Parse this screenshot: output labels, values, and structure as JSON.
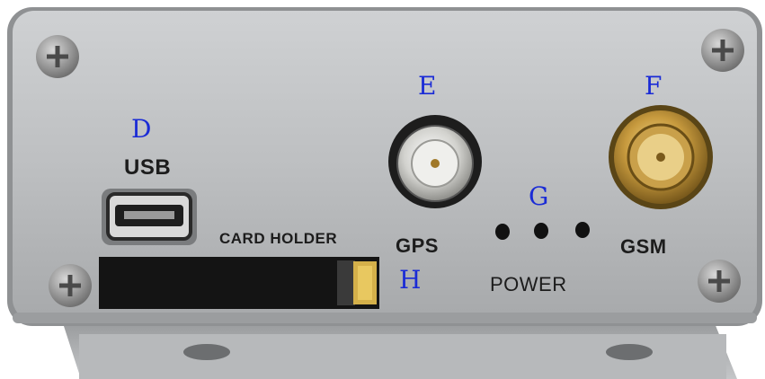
{
  "device": {
    "labels": {
      "usb": "USB",
      "card_holder": "CARD HOLDER",
      "gps": "GPS",
      "gsm": "GSM",
      "power": "POWER"
    },
    "markers": {
      "d": "D",
      "e": "E",
      "f": "F",
      "g": "G",
      "h": "H"
    },
    "colors": {
      "panel": "#b9bcbe",
      "marker_text": "#1a2bd6",
      "gsm_connector": "#c9a04a",
      "gps_connector": "#d6d6d2",
      "card_slot": "#141414",
      "card_latch": "#d4b04a"
    }
  }
}
